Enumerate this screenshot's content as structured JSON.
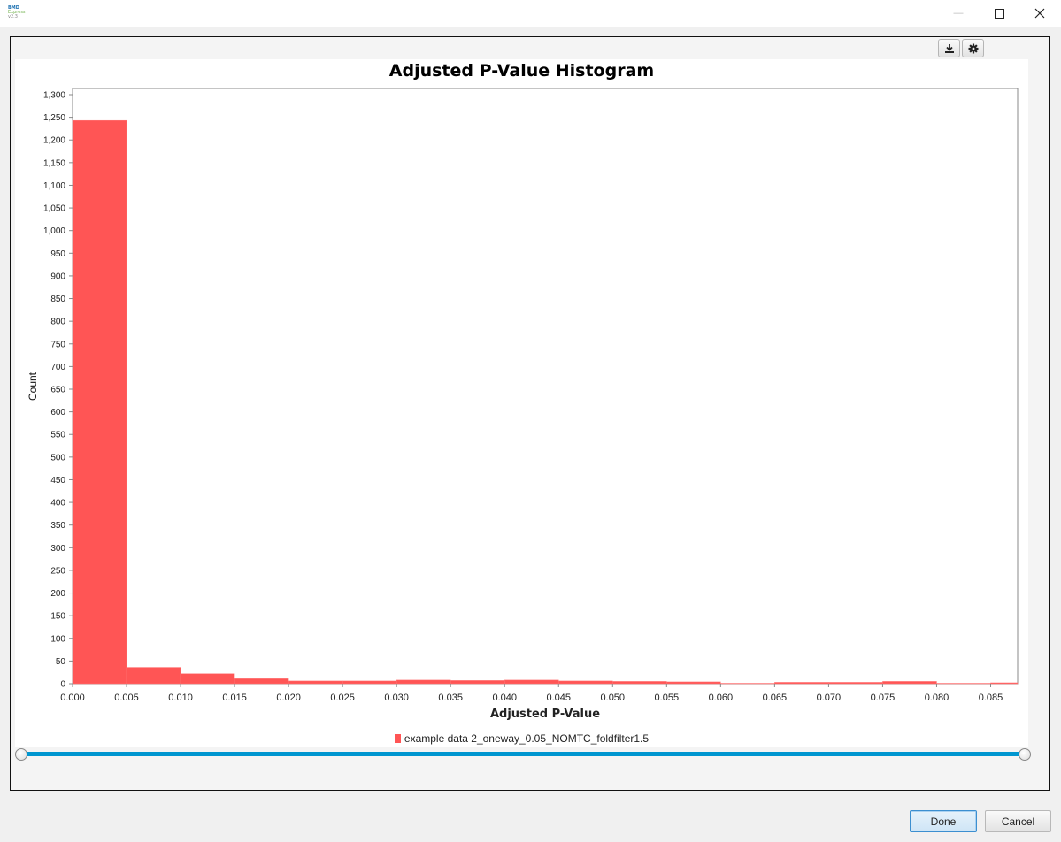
{
  "window": {
    "app_icon_lines": [
      "BMD",
      "Express",
      "v2.3"
    ],
    "close_glyph": "✕",
    "maximize_glyph": "☐",
    "minimize_glyph": "—"
  },
  "toolbar": {
    "download_icon": "download-icon",
    "settings_icon": "gear-icon"
  },
  "chart_data": {
    "type": "bar",
    "title": "Adjusted P-Value Histogram",
    "xlabel": "Adjusted P-Value",
    "ylabel": "Count",
    "xlim": [
      0,
      0.0875
    ],
    "ylim": [
      0,
      1300
    ],
    "x_ticks": [
      "0.000",
      "0.005",
      "0.010",
      "0.015",
      "0.020",
      "0.025",
      "0.030",
      "0.035",
      "0.040",
      "0.045",
      "0.050",
      "0.055",
      "0.060",
      "0.065",
      "0.070",
      "0.075",
      "0.080",
      "0.085"
    ],
    "y_ticks": [
      "0",
      "50",
      "100",
      "150",
      "200",
      "250",
      "300",
      "350",
      "400",
      "450",
      "500",
      "550",
      "600",
      "650",
      "700",
      "750",
      "800",
      "850",
      "900",
      "950",
      "1,000",
      "1,050",
      "1,100",
      "1,150",
      "1,200",
      "1,250",
      "1,300"
    ],
    "bin_width": 0.005,
    "bin_starts": [
      0,
      0.005,
      0.01,
      0.015,
      0.02,
      0.025,
      0.03,
      0.035,
      0.04,
      0.045,
      0.05,
      0.055,
      0.06,
      0.065,
      0.07,
      0.075,
      0.08,
      0.085
    ],
    "series": [
      {
        "name": "example data 2_oneway_0.05_NOMTC_foldfilter1.5",
        "color": "#ff5555",
        "values": [
          1243,
          36,
          22,
          11,
          6,
          6,
          8,
          7,
          8,
          6,
          5,
          4,
          1,
          3,
          3,
          5,
          1,
          2
        ]
      }
    ],
    "grid": false,
    "legend": "bottom-center"
  },
  "slider": {
    "low": 0,
    "high": 1,
    "color": "#0096d0"
  },
  "buttons": {
    "done": "Done",
    "cancel": "Cancel"
  }
}
